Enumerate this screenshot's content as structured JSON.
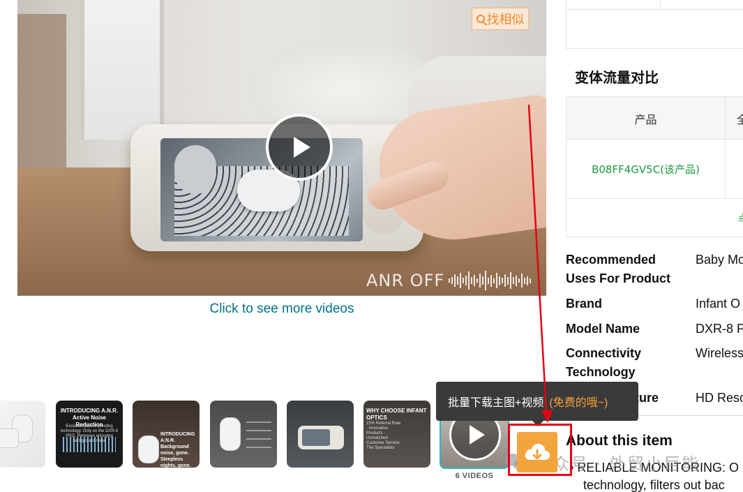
{
  "video": {
    "overlay_text": "ANR OFF",
    "find_similar_label": "找相似",
    "more_videos_link": "Click to see more videos"
  },
  "thumbnails": [
    {
      "title": "",
      "subtitle": ""
    },
    {
      "title": "INTRODUCING A.N.R. Active Noise Reduction",
      "subtitle": "Exclusive parent-pending technology. Only on the DXR-8 PRO. Removes annoying background noise"
    },
    {
      "title": "INTRODUCING A.N.R. Background noise, gone. Sleepless nights, gone.",
      "subtitle": ""
    },
    {
      "title": "",
      "subtitle": ""
    },
    {
      "title": "",
      "subtitle": ""
    },
    {
      "title": "WHY CHOOSE INFANT OPTICS",
      "subtitle": "15% Referral Rate · Innovative Products · Unmatched Customer Service · The Specialists"
    }
  ],
  "videos_count_label": "6 VIDEOS",
  "tooltip": {
    "main": "批量下载主图+视频",
    "free": "(免费的哦~)"
  },
  "icons": {
    "download": "cloud-download-icon",
    "play": "play-icon",
    "search": "search-icon"
  },
  "colors": {
    "accent_orange": "#f4a43c",
    "link_teal": "#007185",
    "asin_green": "#1b9a3c",
    "highlight_red": "#e60012"
  },
  "variant_section": {
    "title": "变体流量对比",
    "column_product": "产品",
    "column_2_partial": "全",
    "asin": "B08FF4GV5C(该产品)",
    "more_partial": "点"
  },
  "specs": [
    {
      "label": "Recommended Uses For Product",
      "value": "Baby Mo"
    },
    {
      "label": "Brand",
      "value": "Infant O"
    },
    {
      "label": "Model Name",
      "value": "DXR-8 P"
    },
    {
      "label": "Connectivity Technology",
      "value": "Wireless"
    },
    {
      "label": "Special Feature",
      "value": "HD Reso"
    }
  ],
  "about": {
    "title": "About this item",
    "bullet_1": "RELIABLE MONITORING: O",
    "bullet_1_cont": "technology, filters out bac"
  },
  "watermark": "公众号 · 外贸小巨能"
}
